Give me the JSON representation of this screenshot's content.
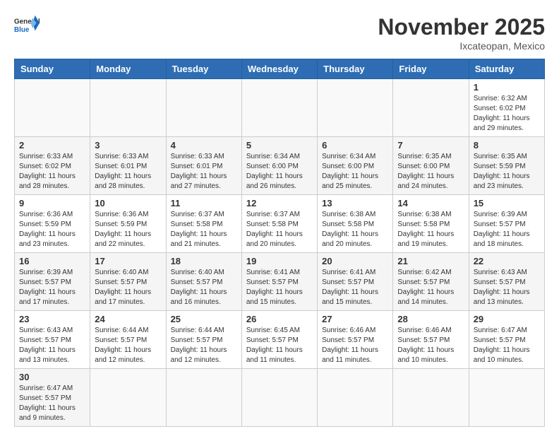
{
  "header": {
    "logo_general": "General",
    "logo_blue": "Blue",
    "month_title": "November 2025",
    "location": "Ixcateopan, Mexico"
  },
  "weekdays": [
    "Sunday",
    "Monday",
    "Tuesday",
    "Wednesday",
    "Thursday",
    "Friday",
    "Saturday"
  ],
  "weeks": [
    [
      {
        "day": "",
        "info": ""
      },
      {
        "day": "",
        "info": ""
      },
      {
        "day": "",
        "info": ""
      },
      {
        "day": "",
        "info": ""
      },
      {
        "day": "",
        "info": ""
      },
      {
        "day": "",
        "info": ""
      },
      {
        "day": "1",
        "info": "Sunrise: 6:32 AM\nSunset: 6:02 PM\nDaylight: 11 hours\nand 29 minutes."
      }
    ],
    [
      {
        "day": "2",
        "info": "Sunrise: 6:33 AM\nSunset: 6:02 PM\nDaylight: 11 hours\nand 28 minutes."
      },
      {
        "day": "3",
        "info": "Sunrise: 6:33 AM\nSunset: 6:01 PM\nDaylight: 11 hours\nand 28 minutes."
      },
      {
        "day": "4",
        "info": "Sunrise: 6:33 AM\nSunset: 6:01 PM\nDaylight: 11 hours\nand 27 minutes."
      },
      {
        "day": "5",
        "info": "Sunrise: 6:34 AM\nSunset: 6:00 PM\nDaylight: 11 hours\nand 26 minutes."
      },
      {
        "day": "6",
        "info": "Sunrise: 6:34 AM\nSunset: 6:00 PM\nDaylight: 11 hours\nand 25 minutes."
      },
      {
        "day": "7",
        "info": "Sunrise: 6:35 AM\nSunset: 6:00 PM\nDaylight: 11 hours\nand 24 minutes."
      },
      {
        "day": "8",
        "info": "Sunrise: 6:35 AM\nSunset: 5:59 PM\nDaylight: 11 hours\nand 23 minutes."
      }
    ],
    [
      {
        "day": "9",
        "info": "Sunrise: 6:36 AM\nSunset: 5:59 PM\nDaylight: 11 hours\nand 23 minutes."
      },
      {
        "day": "10",
        "info": "Sunrise: 6:36 AM\nSunset: 5:59 PM\nDaylight: 11 hours\nand 22 minutes."
      },
      {
        "day": "11",
        "info": "Sunrise: 6:37 AM\nSunset: 5:58 PM\nDaylight: 11 hours\nand 21 minutes."
      },
      {
        "day": "12",
        "info": "Sunrise: 6:37 AM\nSunset: 5:58 PM\nDaylight: 11 hours\nand 20 minutes."
      },
      {
        "day": "13",
        "info": "Sunrise: 6:38 AM\nSunset: 5:58 PM\nDaylight: 11 hours\nand 20 minutes."
      },
      {
        "day": "14",
        "info": "Sunrise: 6:38 AM\nSunset: 5:58 PM\nDaylight: 11 hours\nand 19 minutes."
      },
      {
        "day": "15",
        "info": "Sunrise: 6:39 AM\nSunset: 5:57 PM\nDaylight: 11 hours\nand 18 minutes."
      }
    ],
    [
      {
        "day": "16",
        "info": "Sunrise: 6:39 AM\nSunset: 5:57 PM\nDaylight: 11 hours\nand 17 minutes."
      },
      {
        "day": "17",
        "info": "Sunrise: 6:40 AM\nSunset: 5:57 PM\nDaylight: 11 hours\nand 17 minutes."
      },
      {
        "day": "18",
        "info": "Sunrise: 6:40 AM\nSunset: 5:57 PM\nDaylight: 11 hours\nand 16 minutes."
      },
      {
        "day": "19",
        "info": "Sunrise: 6:41 AM\nSunset: 5:57 PM\nDaylight: 11 hours\nand 15 minutes."
      },
      {
        "day": "20",
        "info": "Sunrise: 6:41 AM\nSunset: 5:57 PM\nDaylight: 11 hours\nand 15 minutes."
      },
      {
        "day": "21",
        "info": "Sunrise: 6:42 AM\nSunset: 5:57 PM\nDaylight: 11 hours\nand 14 minutes."
      },
      {
        "day": "22",
        "info": "Sunrise: 6:43 AM\nSunset: 5:57 PM\nDaylight: 11 hours\nand 13 minutes."
      }
    ],
    [
      {
        "day": "23",
        "info": "Sunrise: 6:43 AM\nSunset: 5:57 PM\nDaylight: 11 hours\nand 13 minutes."
      },
      {
        "day": "24",
        "info": "Sunrise: 6:44 AM\nSunset: 5:57 PM\nDaylight: 11 hours\nand 12 minutes."
      },
      {
        "day": "25",
        "info": "Sunrise: 6:44 AM\nSunset: 5:57 PM\nDaylight: 11 hours\nand 12 minutes."
      },
      {
        "day": "26",
        "info": "Sunrise: 6:45 AM\nSunset: 5:57 PM\nDaylight: 11 hours\nand 11 minutes."
      },
      {
        "day": "27",
        "info": "Sunrise: 6:46 AM\nSunset: 5:57 PM\nDaylight: 11 hours\nand 11 minutes."
      },
      {
        "day": "28",
        "info": "Sunrise: 6:46 AM\nSunset: 5:57 PM\nDaylight: 11 hours\nand 10 minutes."
      },
      {
        "day": "29",
        "info": "Sunrise: 6:47 AM\nSunset: 5:57 PM\nDaylight: 11 hours\nand 10 minutes."
      }
    ],
    [
      {
        "day": "30",
        "info": "Sunrise: 6:47 AM\nSunset: 5:57 PM\nDaylight: 11 hours\nand 9 minutes."
      },
      {
        "day": "",
        "info": ""
      },
      {
        "day": "",
        "info": ""
      },
      {
        "day": "",
        "info": ""
      },
      {
        "day": "",
        "info": ""
      },
      {
        "day": "",
        "info": ""
      },
      {
        "day": "",
        "info": ""
      }
    ]
  ]
}
